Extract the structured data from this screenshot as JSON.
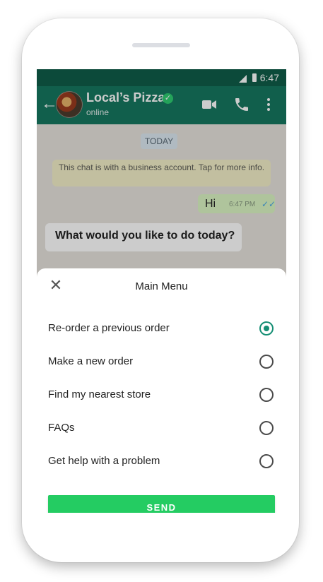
{
  "status_bar": {
    "time": "6:47"
  },
  "header": {
    "title": "Local’s Pizza",
    "verified_icon": "✓",
    "subtitle": "online"
  },
  "chat": {
    "date_chip": "TODAY",
    "system_note": "This chat is with a business account. Tap for more info.",
    "outgoing": {
      "text": "Hi",
      "time": "6:47 PM"
    },
    "incoming": {
      "text": "What would you like to do today?"
    }
  },
  "sheet": {
    "title": "Main Menu",
    "options": [
      {
        "label": "Re-order a previous order",
        "selected": true
      },
      {
        "label": "Make a new order",
        "selected": false
      },
      {
        "label": "Find my nearest store",
        "selected": false
      },
      {
        "label": "FAQs",
        "selected": false
      },
      {
        "label": "Get help with a problem",
        "selected": false
      }
    ],
    "send_label": "SEND"
  },
  "colors": {
    "header": "#16775f",
    "status_bar": "#0f5d49",
    "accent": "#158e74",
    "send_button": "#24cc62",
    "outgoing_bubble": "#dbf5c4"
  },
  "icons": [
    "back-arrow-icon",
    "verified-icon",
    "video-call-icon",
    "voice-call-icon",
    "more-options-icon",
    "close-icon",
    "radio-icon"
  ]
}
